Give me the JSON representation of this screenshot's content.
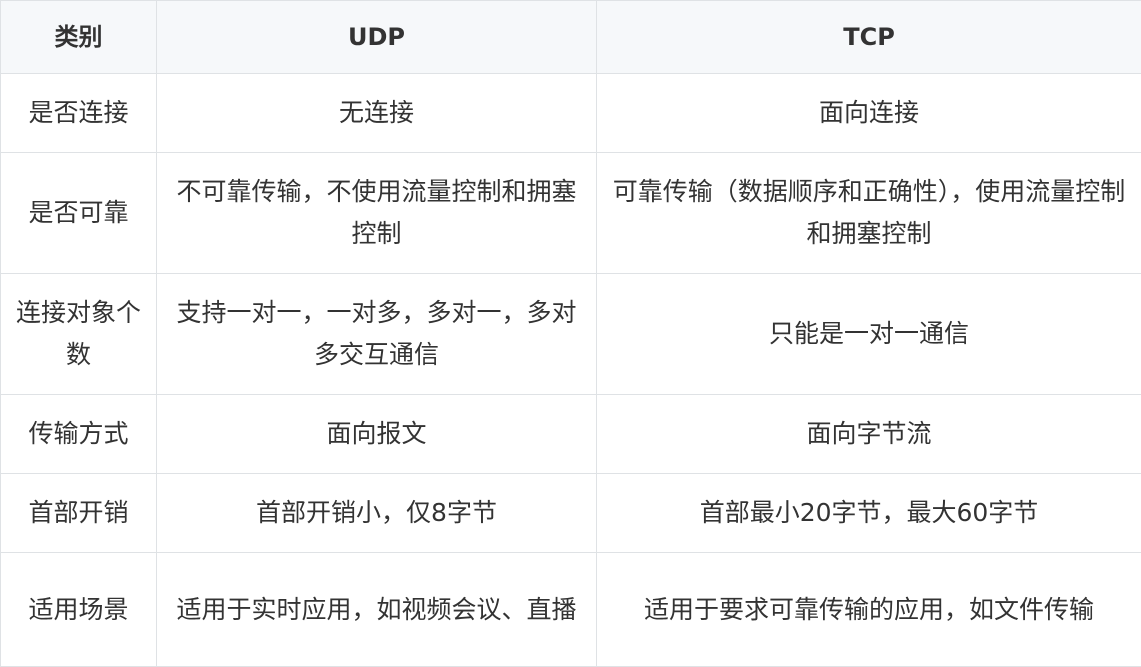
{
  "table": {
    "headers": [
      "类别",
      "UDP",
      "TCP"
    ],
    "rows": [
      [
        "是否连接",
        "无连接",
        "面向连接"
      ],
      [
        "是否可靠",
        "不可靠传输，不使用流量控制和拥塞控制",
        "可靠传输（数据顺序和正确性），使用流量控制和拥塞控制"
      ],
      [
        "连接对象个数",
        "支持一对一，一对多，多对一，多对多交互通信",
        "只能是一对一通信"
      ],
      [
        "传输方式",
        "面向报文",
        "面向字节流"
      ],
      [
        "首部开销",
        "首部开销小，仅8字节",
        "首部最小20字节，最大60字节"
      ],
      [
        "适用场景",
        "适用于实时应用，如视频会议、直播",
        "适用于要求可靠传输的应用，如文件传输"
      ]
    ]
  }
}
